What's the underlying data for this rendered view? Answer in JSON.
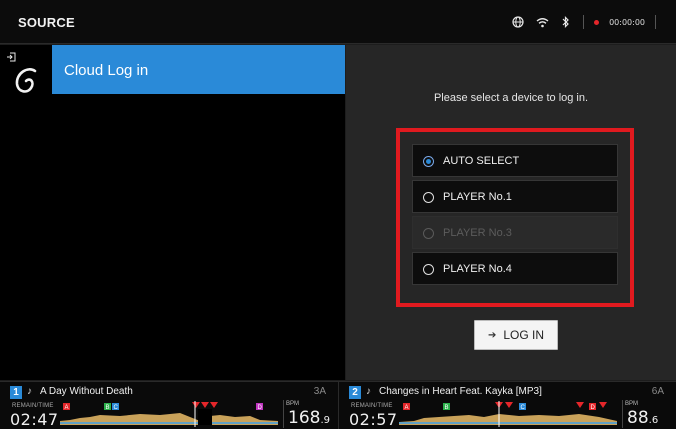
{
  "topbar": {
    "title": "SOURCE",
    "icons": [
      "globe-icon",
      "wifi-icon",
      "bluetooth-icon"
    ],
    "recording_time": "00:00:00"
  },
  "left_panel": {
    "icons": [
      "login-icon",
      "cloud-logo-icon"
    ],
    "selected_item": "Cloud Log in"
  },
  "right_panel": {
    "prompt": "Please select a device to log in.",
    "options": [
      {
        "label": "AUTO SELECT",
        "selected": true,
        "enabled": true
      },
      {
        "label": "PLAYER No.1",
        "selected": false,
        "enabled": true
      },
      {
        "label": "PLAYER No.3",
        "selected": false,
        "enabled": false
      },
      {
        "label": "PLAYER No.4",
        "selected": false,
        "enabled": true
      }
    ],
    "login_button": {
      "icon": "arrow-right-icon",
      "label": "LOG IN"
    }
  },
  "decks": [
    {
      "number": "1",
      "note_icon": "♪",
      "track": "A Day Without Death",
      "key": "3A",
      "remain_label": "REMAIN/TIME",
      "time": "02:47",
      "bpm_label": "BPM",
      "bpm": "168",
      "bpm_decimal": ".9",
      "cue_labels": [
        "A",
        "B",
        "C",
        "D"
      ]
    },
    {
      "number": "2",
      "note_icon": "♪",
      "track": "Changes in Heart Feat. Kayka [MP3]",
      "key": "6A",
      "remain_label": "REMAIN/TIME",
      "time": "02:57",
      "bpm_label": "BPM",
      "bpm": "88",
      "bpm_decimal": ".6",
      "cue_labels": [
        "A",
        "B",
        "C",
        "D"
      ]
    }
  ],
  "colors": {
    "accent": "#2a8ad8",
    "highlight_border": "#e01a1f",
    "record": "#e4262a"
  }
}
